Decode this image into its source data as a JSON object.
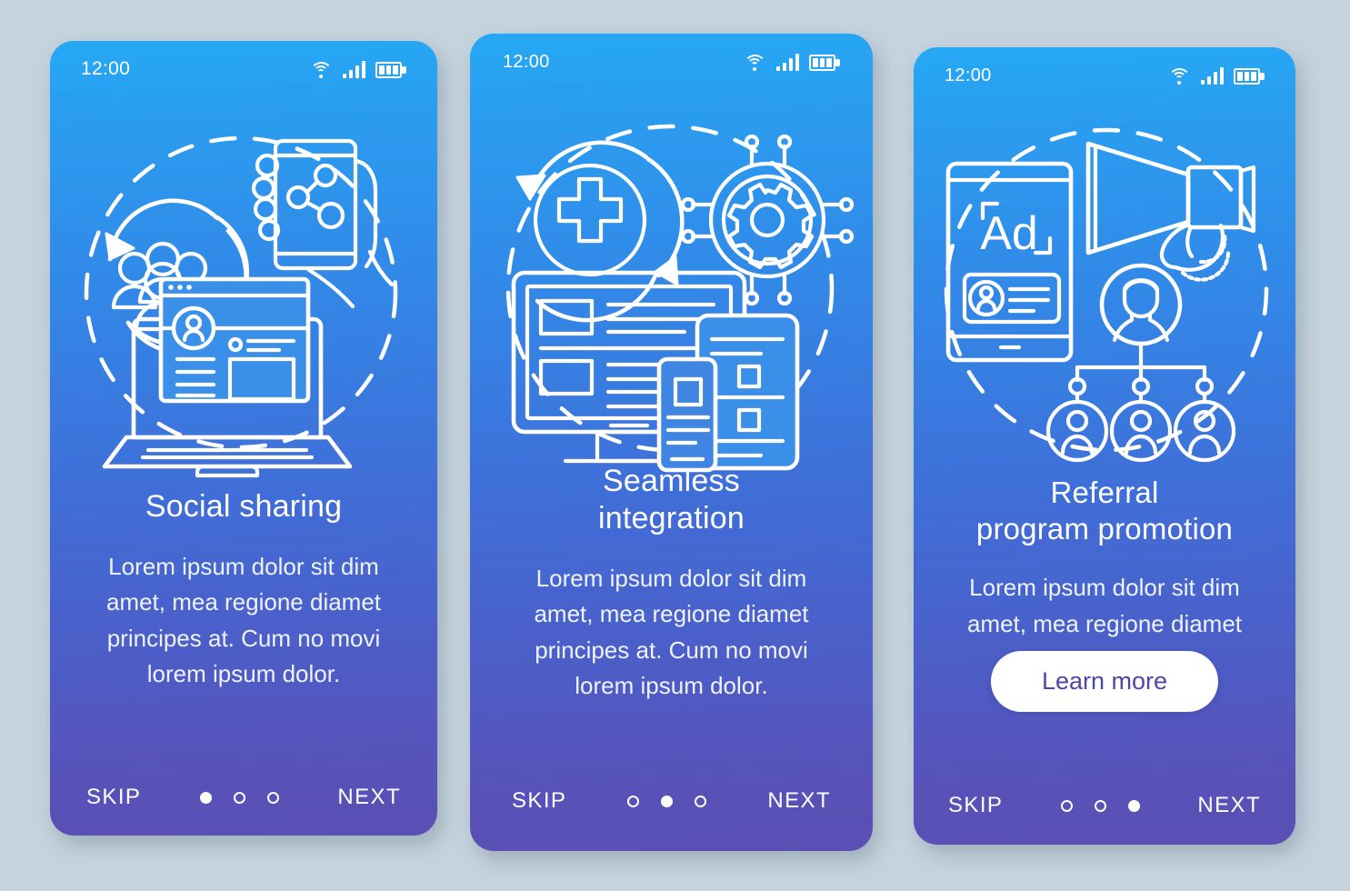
{
  "meta": {
    "background_color": "#c5d3dd",
    "gradient_top": "#25a8f4",
    "gradient_mid": "#3f6fd9",
    "gradient_bottom": "#5a4fb4",
    "accent_text": "#4e46a8"
  },
  "screens": [
    {
      "id": "social-sharing",
      "status": {
        "time": "12:00",
        "wifi": "wifi-icon",
        "signal": "signal-bars-icon",
        "battery": "battery-icon"
      },
      "illustration": "social-sharing-illustration",
      "title": "Social sharing",
      "title_lines": [
        "Social sharing"
      ],
      "body": "Lorem ipsum dolor sit dim amet, mea regione diamet principes at. Cum no movi lorem ipsum dolor.",
      "body_lines": [
        "Lorem ipsum dolor sit dim",
        "amet, mea regione diamet",
        "principes at. Cum no movi",
        "lorem ipsum dolor."
      ],
      "cta": null,
      "footer": {
        "skip": "SKIP",
        "next": "NEXT",
        "dot_count": 3,
        "active_dot": 1
      }
    },
    {
      "id": "seamless-integration",
      "status": {
        "time": "12:00",
        "wifi": "wifi-icon",
        "signal": "signal-bars-icon",
        "battery": "battery-icon"
      },
      "illustration": "seamless-integration-illustration",
      "title": "Seamless integration",
      "title_lines": [
        "Seamless",
        "integration"
      ],
      "body": "Lorem ipsum dolor sit dim amet, mea regione diamet principes at. Cum no movi lorem ipsum dolor.",
      "body_lines": [
        "Lorem ipsum dolor sit dim",
        "amet, mea regione diamet",
        "principes at. Cum no movi",
        "lorem ipsum dolor."
      ],
      "cta": null,
      "footer": {
        "skip": "SKIP",
        "next": "NEXT",
        "dot_count": 3,
        "active_dot": 2
      }
    },
    {
      "id": "referral-program-promotion",
      "status": {
        "time": "12:00",
        "wifi": "wifi-icon",
        "signal": "signal-bars-icon",
        "battery": "battery-icon"
      },
      "illustration": "referral-program-illustration",
      "illustration_label": "Ad",
      "title": "Referral program promotion",
      "title_lines": [
        "Referral",
        "program promotion"
      ],
      "body": "Lorem ipsum dolor sit dim amet, mea regione diamet",
      "body_lines": [
        "Lorem ipsum dolor sit dim",
        "amet, mea regione diamet"
      ],
      "cta": "Learn more",
      "footer": {
        "skip": "SKIP",
        "next": "NEXT",
        "dot_count": 3,
        "active_dot": 3
      }
    }
  ]
}
